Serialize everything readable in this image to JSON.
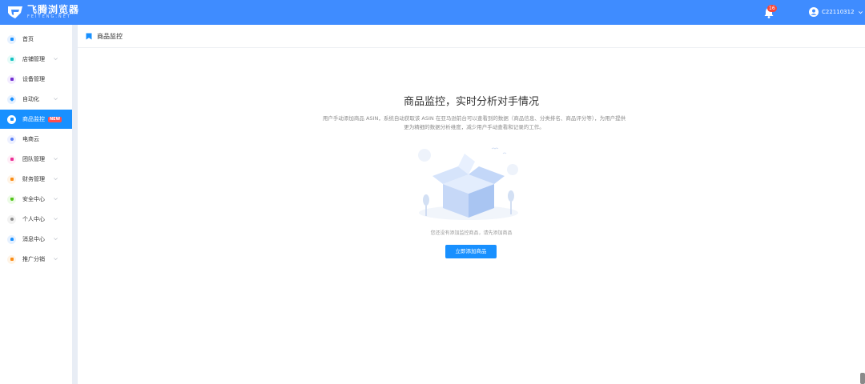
{
  "header": {
    "logo_cn": "飞腾浏览器",
    "logo_en": "FEITENG.NET",
    "notification_count": "16",
    "username": "C22110312",
    "bell_icon": "bell-icon",
    "user_icon": "user-circle-icon",
    "accent_color": "#3f8cff"
  },
  "sidebar": {
    "items": [
      {
        "label": "首页",
        "icon": "home-icon",
        "color": "#1890ff",
        "has_arrow": false
      },
      {
        "label": "店铺管理",
        "icon": "shop-icon",
        "color": "#13c2c2",
        "has_arrow": true
      },
      {
        "label": "设备管理",
        "icon": "device-icon",
        "color": "#722ed1",
        "has_arrow": false
      },
      {
        "label": "自动化",
        "icon": "automation-icon",
        "color": "#1890ff",
        "has_arrow": true
      },
      {
        "label": "商品监控",
        "icon": "monitor-icon",
        "color": "#1890ff",
        "has_arrow": false,
        "active": true,
        "tag": "NEW"
      },
      {
        "label": "电商云",
        "icon": "cloud-icon",
        "color": "#597ef7",
        "has_arrow": false
      },
      {
        "label": "团队管理",
        "icon": "team-icon",
        "color": "#eb2f96",
        "has_arrow": true
      },
      {
        "label": "财务管理",
        "icon": "finance-icon",
        "color": "#fa8c16",
        "has_arrow": true
      },
      {
        "label": "安全中心",
        "icon": "shield-icon",
        "color": "#52c41a",
        "has_arrow": true
      },
      {
        "label": "个人中心",
        "icon": "person-icon",
        "color": "#8c8c8c",
        "has_arrow": true
      },
      {
        "label": "消息中心",
        "icon": "message-icon",
        "color": "#1890ff",
        "has_arrow": true
      },
      {
        "label": "推广分销",
        "icon": "promote-icon",
        "color": "#fa8c16",
        "has_arrow": true
      }
    ]
  },
  "breadcrumb": {
    "label": "商品监控"
  },
  "main": {
    "title": "商品监控，实时分析对手情况",
    "description": "用户手动添加商品 ASIN，系统自动获取该 ASIN 在亚马逊前台可以查看到的数据（商品信息、分类排名、商品评分等），为用户提供更为精细的数据分析维度，减少用户手动查看和记录的工作。",
    "empty_text": "您还没有添加监控商品，请先添加商品",
    "add_button": "立即添加商品"
  }
}
